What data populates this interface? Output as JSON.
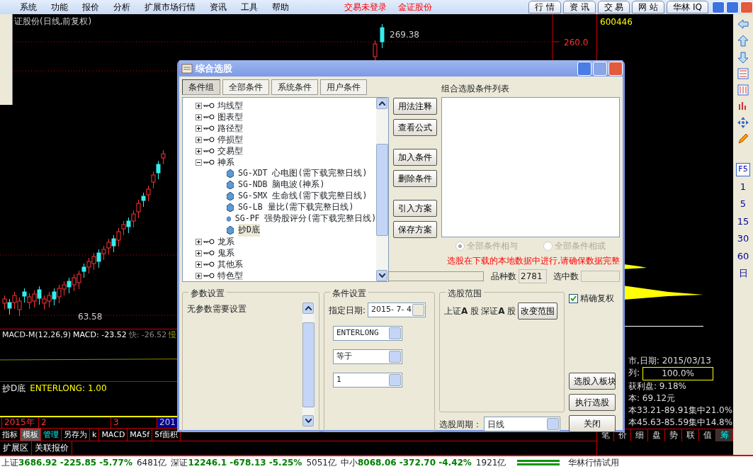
{
  "menu": {
    "items": [
      "系统",
      "功能",
      "报价",
      "分析",
      "扩展市场行情",
      "资讯",
      "工具",
      "帮助"
    ],
    "notices": [
      "交易未登录",
      "金证股份"
    ],
    "buttons": [
      "行 情",
      "资 讯",
      "交 易",
      "网 站",
      "华林 IQ"
    ]
  },
  "chart": {
    "title": "证股份(日线,前复权)",
    "high_label": "269.38",
    "low_label": "63.58",
    "price_tick": "260.0",
    "macd": {
      "name": "MACD-M(12,26,9)",
      "value": "MACD: -23.52",
      "fast": "快: -26.52",
      "slow": "慢"
    },
    "indicator": {
      "name": "抄D底",
      "value": "ENTERLONG: 1.00"
    },
    "dates": [
      {
        "label": "2015年",
        "selected": false
      },
      {
        "label": "2",
        "selected": false
      },
      {
        "label": "3",
        "selected": false
      },
      {
        "label": "201",
        "selected": true
      }
    ],
    "tabs": [
      {
        "label": "指标",
        "selected": false,
        "kind": "tab"
      },
      {
        "label": "模板",
        "selected": true,
        "kind": "tab"
      },
      {
        "label": "管理",
        "selected": false,
        "kind": "manage"
      },
      {
        "label": "另存为",
        "selected": false,
        "kind": "tab"
      },
      {
        "label": "k",
        "selected": false,
        "kind": "tab"
      },
      {
        "label": "MACD",
        "selected": false,
        "kind": "tab"
      },
      {
        "label": "MA5f",
        "selected": false,
        "kind": "tab"
      },
      {
        "label": "5f面积",
        "selected": false,
        "kind": "tab"
      }
    ],
    "extra_tabs": [
      "扩展区",
      "关联报价"
    ]
  },
  "info": {
    "code": "600446",
    "lines": [
      "市,日期: 2015/03/13",
      "获利盘: 9.18%",
      "本: 69.12元",
      "本33.21-89.91集中21.0%",
      "本45.63-85.59集中14.8%"
    ],
    "ratio_label": "列:",
    "ratio": "100.0%",
    "tabs": [
      {
        "label": "笔",
        "selected": false
      },
      {
        "label": "价",
        "selected": false
      },
      {
        "label": "细",
        "selected": false
      },
      {
        "label": "盘",
        "selected": false
      },
      {
        "label": "势",
        "selected": false
      },
      {
        "label": "联",
        "selected": false
      },
      {
        "label": "值",
        "selected": false
      },
      {
        "label": "筹",
        "selected": true
      }
    ]
  },
  "toolbar": {
    "labels": [
      "F5"
    ],
    "periods": [
      "1",
      "5",
      "15",
      "30",
      "60",
      "日"
    ]
  },
  "status_bar": {
    "indices": [
      {
        "name": "上证",
        "value": "3686.92",
        "change": "-225.85",
        "pct": "-5.77%",
        "amount": "6481亿"
      },
      {
        "name": "深证",
        "value": "12246.1",
        "change": "-678.13",
        "pct": "-5.25%",
        "amount": "5051亿"
      },
      {
        "name": "中小",
        "value": "8068.06",
        "change": "-372.70",
        "pct": "-4.42%",
        "amount": "1921亿"
      }
    ],
    "label": "华林行情试用"
  },
  "dialog": {
    "title": "综合选股",
    "tabs": [
      {
        "label": "条件组",
        "selected": true
      },
      {
        "label": "全部条件",
        "selected": false
      },
      {
        "label": "系统条件",
        "selected": false
      },
      {
        "label": "用户条件",
        "selected": false
      }
    ],
    "tree": [
      {
        "label": "均线型",
        "expanded": false
      },
      {
        "label": "图表型",
        "expanded": false
      },
      {
        "label": "路径型",
        "expanded": false
      },
      {
        "label": "停损型",
        "expanded": false
      },
      {
        "label": "交易型",
        "expanded": false
      },
      {
        "label": "神系",
        "expanded": true,
        "children": [
          {
            "label": "SG-XDT 心电图(需下载完整日线)",
            "selected": false
          },
          {
            "label": "SG-NDB 脑电波(神系)",
            "selected": false
          },
          {
            "label": "SG-SMX 生命线(需下载完整日线)",
            "selected": false
          },
          {
            "label": "SG-LB 量比(需下载完整日线)",
            "selected": false
          },
          {
            "label": "SG-PF 强势股评分(需下载完整日线)",
            "selected": false
          },
          {
            "label": "抄D底",
            "selected": true
          }
        ]
      },
      {
        "label": "龙系",
        "expanded": false
      },
      {
        "label": "鬼系",
        "expanded": false
      },
      {
        "label": "其他系",
        "expanded": false
      },
      {
        "label": "特色型",
        "expanded": false
      }
    ],
    "side_buttons": [
      "用法注释",
      "查看公式",
      "加入条件",
      "删除条件",
      "引入方案",
      "保存方案"
    ],
    "list_title": "组合选股条件列表",
    "logic": [
      {
        "label": "全部条件相与",
        "selected": true,
        "disabled": true
      },
      {
        "label": "全部条件相或",
        "selected": false,
        "disabled": true
      }
    ],
    "warning": "选股在下载的本地数据中进行,请确保数据完整",
    "count_label": "品种数",
    "count": "2781",
    "picked_label": "选中数",
    "params": {
      "title": "参数设置",
      "text": "无参数需要设置"
    },
    "conditions": {
      "title": "条件设置",
      "date_label": "指定日期:",
      "date": "2015- 7- 4",
      "selects": [
        "ENTERLONG",
        "等于",
        "1"
      ]
    },
    "scope": {
      "title": "选股范围",
      "markets": [
        "上证**A** 股",
        "深证**A** 股"
      ],
      "change_button": "改变范围",
      "period_label": "选股周期：",
      "period": "日线"
    },
    "exact": {
      "label": "精确复权",
      "checked": true
    },
    "actions": [
      "选股入板块",
      "执行选股",
      "关闭"
    ]
  }
}
